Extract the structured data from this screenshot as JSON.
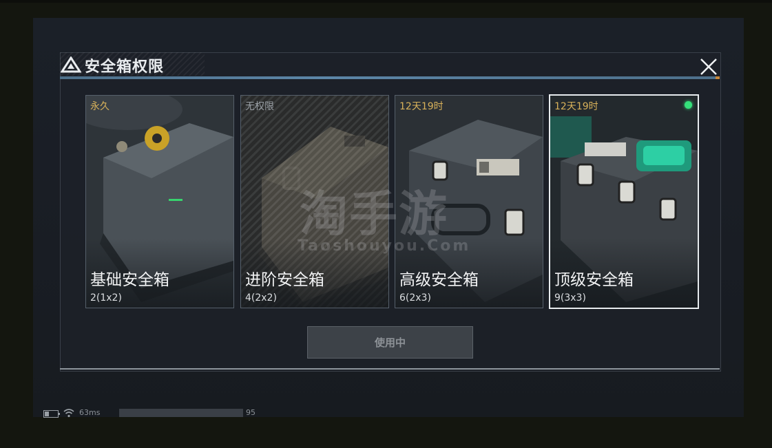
{
  "dialog": {
    "title": "安全箱权限",
    "close_icon": "close-icon",
    "logo_icon": "triangle-logo-icon"
  },
  "cases": [
    {
      "tag": "永久",
      "tag_color": "#d9b25a",
      "name": "基础安全箱",
      "size": "2(1x2)",
      "locked": false,
      "selected": false
    },
    {
      "tag": "无权限",
      "tag_color": "#9aa0a6",
      "name": "进阶安全箱",
      "size": "4(2x2)",
      "locked": true,
      "selected": false
    },
    {
      "tag": "12天19时",
      "tag_color": "#d9b25a",
      "name": "高级安全箱",
      "size": "6(2x3)",
      "locked": false,
      "selected": false
    },
    {
      "tag": "12天19时",
      "tag_color": "#d9b25a",
      "name": "顶级安全箱",
      "size": "9(3x3)",
      "locked": false,
      "selected": true
    }
  ],
  "watermark": {
    "main": "淘手游",
    "sub": "Taoshouyou.Com"
  },
  "use_button": {
    "label": "使用中"
  },
  "status": {
    "ping": "63ms",
    "fps": "95",
    "active_indicator_color": "#35e07a"
  }
}
